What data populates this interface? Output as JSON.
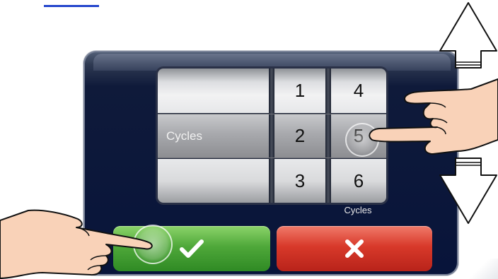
{
  "picker": {
    "column_1": {
      "selected_label": "Cycles"
    },
    "column_2": {
      "values": [
        "1",
        "2",
        "3"
      ]
    },
    "column_3": {
      "values": [
        "4",
        "5",
        "6"
      ]
    },
    "caption": "Cycles"
  },
  "colors": {
    "panel": "#08143a",
    "confirm_button": "#4fa83a",
    "cancel_button": "#d8392a"
  },
  "icons": {
    "confirm": "checkmark-icon",
    "cancel": "x-icon",
    "scroll_up": "arrow-up-icon",
    "scroll_down": "arrow-down-icon",
    "touch": "hand-pointer-icon"
  }
}
